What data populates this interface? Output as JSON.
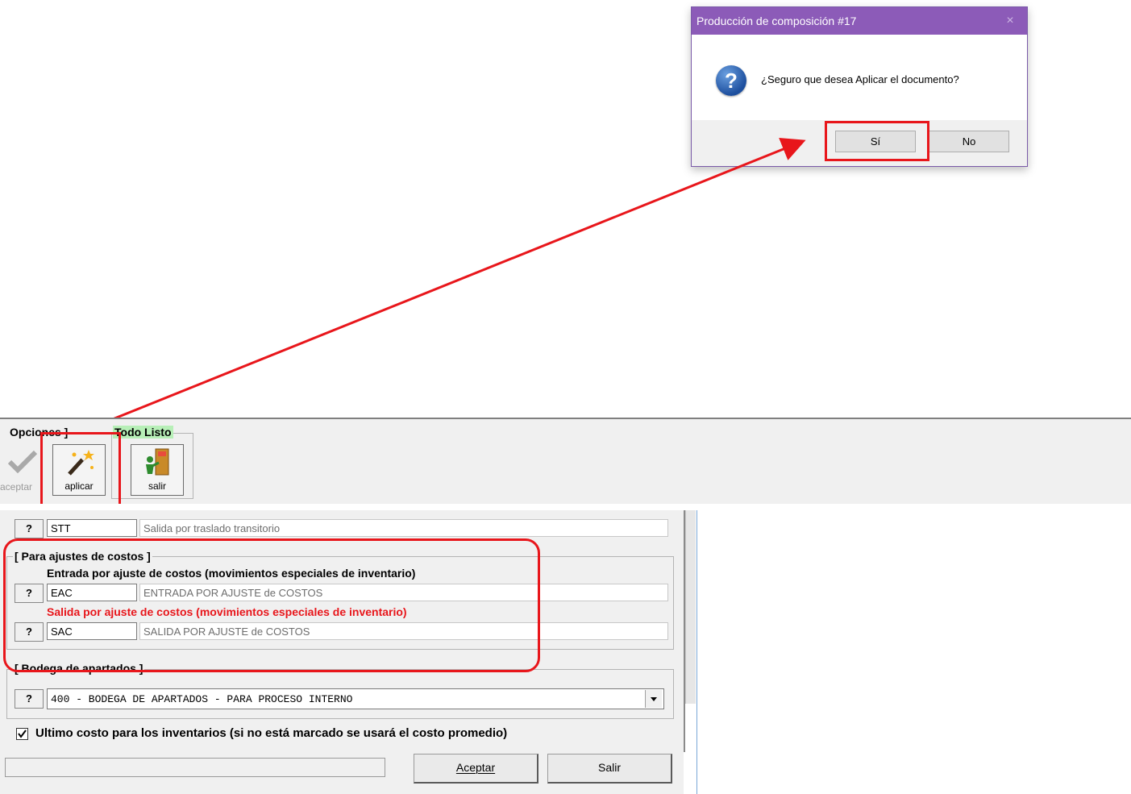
{
  "dialog": {
    "title": "Producción de composición #17",
    "close": "×",
    "message": "¿Seguro que desea Aplicar el documento?",
    "yes_label": "Sí",
    "no_label": "No",
    "icon": "question-icon"
  },
  "toolbar": {
    "options_label": "Opciones ]",
    "status_label": "Todo Listo",
    "buttons": [
      {
        "label": "aceptar",
        "icon": "checkmark-icon"
      },
      {
        "label": "aplicar",
        "icon": "magic-wand-icon"
      },
      {
        "label": "salir",
        "icon": "exit-door-icon"
      }
    ]
  },
  "form": {
    "stt": {
      "code": "STT",
      "desc": "Salida por traslado transitorio"
    },
    "ajustes": {
      "title": "[ Para ajustes de costos ]",
      "entrada_label": "Entrada por ajuste de costos (movimientos especiales de inventario)",
      "entrada_code": "EAC",
      "entrada_desc": "ENTRADA POR AJUSTE de COSTOS",
      "salida_label": "Salida por ajuste de costos (movimientos especiales de inventario)",
      "salida_code": "SAC",
      "salida_desc": "SALIDA POR AJUSTE de COSTOS"
    },
    "bodega": {
      "title": "[ Bodega de apartados ]",
      "selected": "400 - BODEGA DE APARTADOS - PARA PROCESO INTERNO"
    },
    "checkbox_label": "Ultimo costo para los inventarios (si no está marcado se usará el costo promedio)",
    "checkbox_checked": true,
    "aceptar_label": "Aceptar",
    "salir_label": "Salir",
    "q_label": "?"
  },
  "colors": {
    "dialog_title_bg": "#8c5bb8",
    "annotation_red": "#e8161b",
    "salida_label_color": "#e8161b",
    "status_bg": "#b7efb7"
  }
}
